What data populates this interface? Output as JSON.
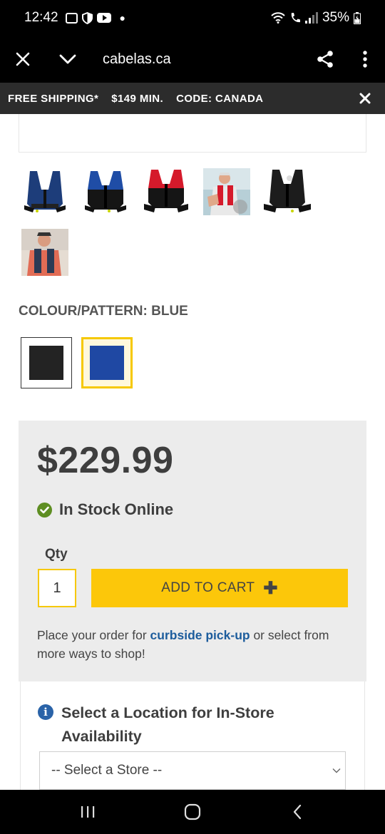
{
  "status_bar": {
    "time": "12:42",
    "battery": "35%",
    "icons": [
      "gallery-icon",
      "shield-icon",
      "youtube-icon",
      "wifi-icon",
      "call-icon",
      "signal-icon",
      "battery-icon"
    ]
  },
  "browser": {
    "url": "cabelas.ca"
  },
  "promo": {
    "shipping": "FREE SHIPPING*",
    "minimum": "$149 MIN.",
    "code": "CODE: CANADA"
  },
  "thumbnails": [
    {
      "name": "vest-navy-front",
      "color": "#1d3d7a"
    },
    {
      "name": "vest-blue-front",
      "color": "#1f4da6"
    },
    {
      "name": "vest-red-front",
      "color": "#d51a2b"
    },
    {
      "name": "man-wearing-red-vest-photo",
      "color": "#c94a42"
    },
    {
      "name": "vest-black-front",
      "color": "#1c1c1c"
    },
    {
      "name": "man-wearing-vest-photo",
      "color": "#2b3a55"
    }
  ],
  "colour": {
    "label": "COLOUR/PATTERN:",
    "value": "BLUE",
    "swatches": [
      {
        "name": "black",
        "color": "#232323",
        "selected": false
      },
      {
        "name": "blue",
        "color": "#1f48a3",
        "selected": true
      }
    ]
  },
  "buy": {
    "price": "$229.99",
    "stock": "In Stock Online",
    "qty_label": "Qty",
    "qty_value": "1",
    "add_to_cart": "ADD TO CART",
    "pickup_prefix": "Place your order for ",
    "pickup_link": "curbside pick-up",
    "pickup_suffix": " or select from more ways to shop!"
  },
  "location": {
    "title": "Select a Location for In-Store Availability",
    "select_placeholder": "-- Select a Store --"
  },
  "nav": {
    "icons": [
      "recent-apps-icon",
      "home-icon",
      "back-icon"
    ]
  }
}
